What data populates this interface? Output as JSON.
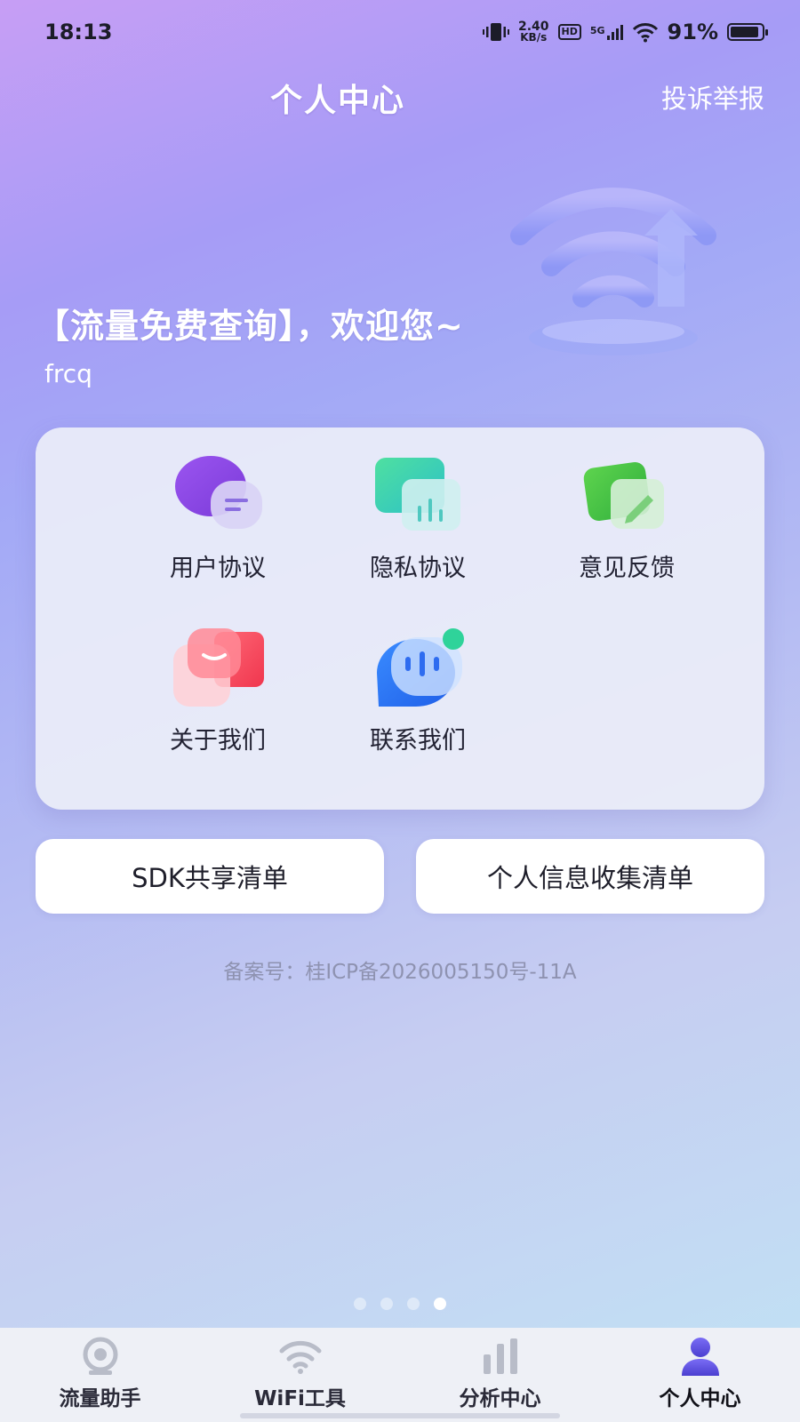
{
  "status_bar": {
    "time": "18:13",
    "net_speed_value": "2.40",
    "net_speed_unit": "KB/s",
    "hd_label": "HD",
    "network_label": "5G",
    "battery": "91%",
    "battery_level": 0.91
  },
  "header": {
    "title": "个人中心",
    "report_link": "投诉举报"
  },
  "welcome": {
    "text": "【流量免费查询】，欢迎您~",
    "username": "frcq"
  },
  "menu": {
    "items": [
      {
        "label": "用户协议",
        "icon": "chat-bubbles-icon"
      },
      {
        "label": "隐私协议",
        "icon": "chart-card-icon"
      },
      {
        "label": "意见反馈",
        "icon": "edit-note-icon"
      },
      {
        "label": "关于我们",
        "icon": "smile-card-icon"
      },
      {
        "label": "联系我们",
        "icon": "message-bubble-icon"
      }
    ]
  },
  "buttons": {
    "sdk_list": "SDK共享清单",
    "personal_info_list": "个人信息收集清单"
  },
  "icp": "备案号：桂ICP备2026005150号-11A",
  "pager": {
    "total": 4,
    "active": 4
  },
  "tabbar": {
    "tabs": [
      {
        "label": "流量助手",
        "icon": "camera-icon",
        "active": false
      },
      {
        "label": "WiFi工具",
        "icon": "wifi-icon",
        "active": false
      },
      {
        "label": "分析中心",
        "icon": "bar-chart-icon",
        "active": false
      },
      {
        "label": "个人中心",
        "icon": "user-icon",
        "active": true
      }
    ]
  },
  "colors": {
    "accent_purple": "#6b5cf0",
    "tab_active_icon": "#5a4fd8",
    "background_top": "#c79ef5",
    "background_bottom": "#bfe3f4"
  }
}
